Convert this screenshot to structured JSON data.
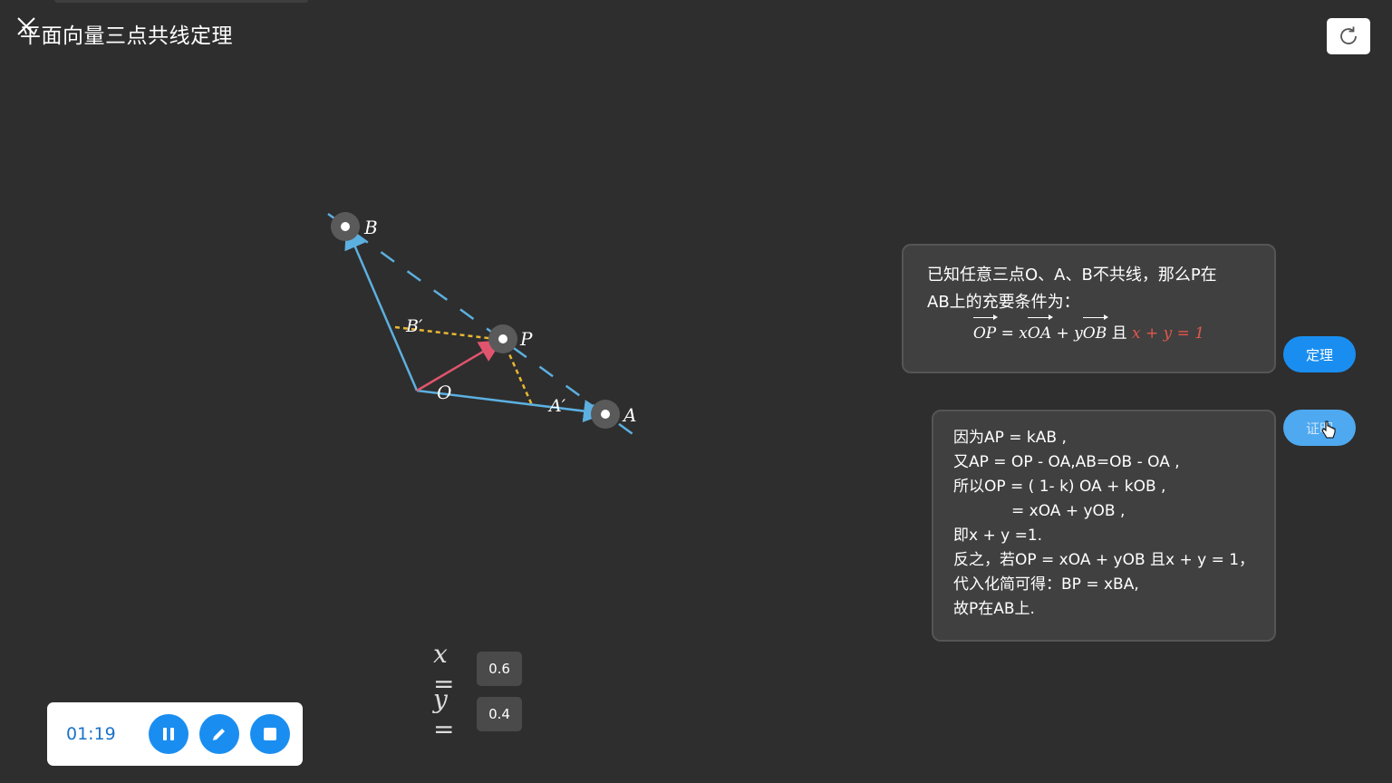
{
  "header": {
    "title": "平面向量三点共线定理"
  },
  "diagram": {
    "points": [
      {
        "id": "B",
        "label": "B"
      },
      {
        "id": "P",
        "label": "P"
      },
      {
        "id": "A",
        "label": "A"
      },
      {
        "id": "O",
        "label": "O"
      },
      {
        "id": "Bp",
        "label": "B′"
      },
      {
        "id": "Ap",
        "label": "A′"
      }
    ],
    "colors": {
      "vector": "#5cb0e0",
      "op": "#e0546e",
      "dotted": "#e8b832",
      "handle": "#5a5a5a"
    }
  },
  "theorem": {
    "line1": "已知任意三点O、A、B不共线，那么P在",
    "line2": "AB上的充要条件为：",
    "formula": {
      "op": "OP",
      "eq1": " = x",
      "oa": "OA",
      "plus": " + y",
      "ob": "OB",
      "and": " 且 ",
      "cond": "x + y = 1"
    }
  },
  "proof": {
    "lines": [
      "因为AP = kAB ,",
      "又AP = OP - OA,AB=OB - OA ,",
      "所以OP = ( 1- k) OA + kOB ,",
      "= xOA + yOB ,",
      "即x + y =1.",
      "反之，若OP = xOA + yOB 且x + y = 1，",
      "代入化简可得：BP = xBA,",
      "故P在AB上."
    ]
  },
  "buttons": {
    "theorem": "定理",
    "proof": "证明"
  },
  "params": {
    "x_label": "x =",
    "x_value": "0.6",
    "y_label": "y =",
    "y_value": "0.4"
  },
  "player": {
    "time": "01:19",
    "colors": {
      "accent": "#1a8ef0"
    }
  },
  "icons": [
    "close-icon",
    "refresh-icon",
    "pause-icon",
    "pencil-icon",
    "stop-icon",
    "hand-cursor-icon"
  ]
}
